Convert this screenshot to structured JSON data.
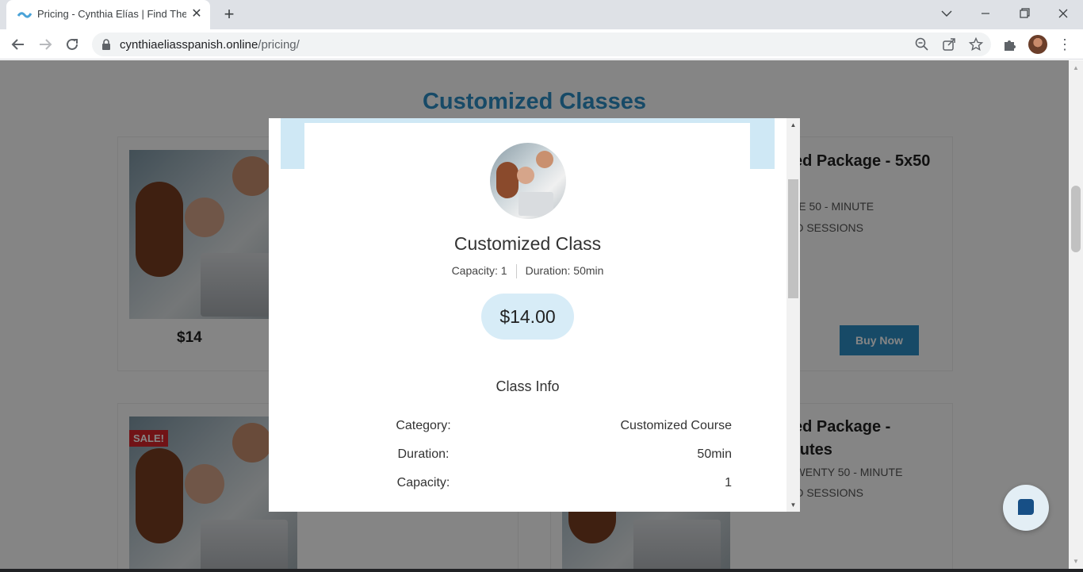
{
  "browser": {
    "tab_title": "Pricing - Cynthia Elías | Find The Best",
    "close_tab_glyph": "✕",
    "new_tab_glyph": "+",
    "url_domain": "cynthiaeliasspanish.online",
    "url_path": "/pricing/"
  },
  "page": {
    "title": "Customized Classes",
    "cards": {
      "single_price": "$14",
      "package_5_title": "zed Package - 5x50",
      "package_5_desc_1": "IVE 50 - MINUTE",
      "package_5_desc_2": "ED SESSIONS",
      "buy_now_label": "Buy Now",
      "sale_badge": "SALE!",
      "package_20_title_1": "zed Package -",
      "package_20_title_2": "inutes",
      "package_20_desc_1": "TWENTY 50 - MINUTE",
      "package_20_desc_2": "ED SESSIONS"
    }
  },
  "modal": {
    "class_title": "Customized Class",
    "capacity_meta": "Capacity: 1",
    "duration_meta": "Duration: 50min",
    "price": "$14.00",
    "info_heading": "Class Info",
    "rows": [
      {
        "label": "Category:",
        "value": "Customized Course"
      },
      {
        "label": "Duration:",
        "value": "50min"
      },
      {
        "label": "Capacity:",
        "value": "1"
      }
    ]
  },
  "colors": {
    "brand_blue": "#2d8fc6",
    "modal_band": "#cfe8f5",
    "price_pill": "#d7ecf7",
    "sale_red": "#d9262b"
  },
  "icons": [
    "favicon-icon",
    "close-icon",
    "plus-icon",
    "chevron-down-icon",
    "minimize-icon",
    "restore-icon",
    "window-close-icon",
    "back-icon",
    "forward-icon",
    "reload-icon",
    "lock-icon",
    "zoom-icon",
    "share-icon",
    "star-icon",
    "extensions-icon",
    "profile-avatar",
    "menu-icon",
    "chat-icon"
  ]
}
